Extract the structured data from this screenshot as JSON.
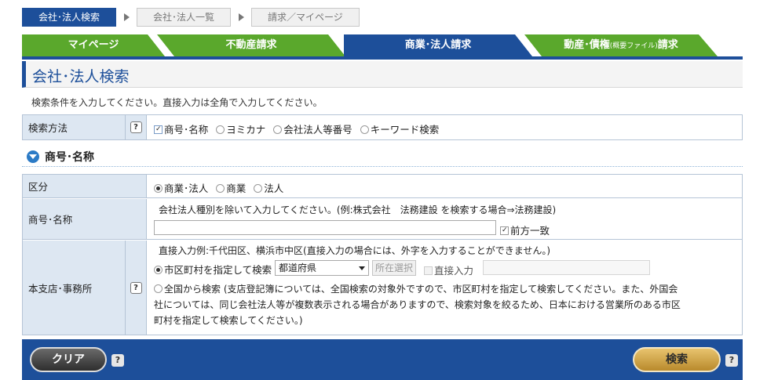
{
  "breadcrumb": {
    "items": [
      {
        "label": "会社･法人検索"
      },
      {
        "label": "会社･法人一覧"
      },
      {
        "label": "請求／マイページ"
      }
    ]
  },
  "tabs": [
    {
      "label": "マイページ"
    },
    {
      "label": "不動産請求"
    },
    {
      "label": "商業･法人請求"
    },
    {
      "label": "動産･債権",
      "small": "(概要ファイル)",
      "suffix": "請求"
    }
  ],
  "page": {
    "title": "会社･法人検索",
    "instruction": "検索条件を入力してください。直接入力は全角で入力してください。"
  },
  "search_method": {
    "label": "検索方法",
    "options": [
      "商号･名称",
      "ヨミカナ",
      "会社法人等番号",
      "キーワード検索"
    ],
    "selected": "商号･名称"
  },
  "section": {
    "title": "商号･名称"
  },
  "kubun": {
    "label": "区分",
    "options": [
      "商業･法人",
      "商業",
      "法人"
    ],
    "selected": "商業･法人"
  },
  "shogo": {
    "label": "商号･名称",
    "note": "会社法人種別を除いて入力してください。(例:株式会社　法務建設 を検索する場合⇒法務建設)",
    "value": "",
    "prefix_match_label": "前方一致",
    "prefix_match_checked": true
  },
  "branch": {
    "label": "本支店･事務所",
    "example": "直接入力例:千代田区、横浜市中区(直接入力の場合には、外字を入力することができません。)",
    "option_city": "市区町村を指定して検索",
    "prefecture_select": "都道府県",
    "location_button": "所在選択",
    "direct_input_label": "直接入力",
    "option_nationwide": "全国から検索",
    "nationwide_line1": "(支店登記簿については、全国検索の対象外ですので、市区町村を指定して検索してください。また、外国会",
    "nationwide_line2": "社については、同じ会社法人等が複数表示される場合がありますので、検索対象を絞るため、日本における営業所のある市区",
    "nationwide_line3": "町村を指定して検索してください。)"
  },
  "actions": {
    "clear_label": "クリア",
    "search_label": "検索",
    "help_glyph": "?"
  },
  "colors": {
    "primary_blue": "#1d4f9a",
    "tab_green": "#5aa82c",
    "label_bg": "#dde7f2",
    "search_button": "#d4a84e"
  }
}
